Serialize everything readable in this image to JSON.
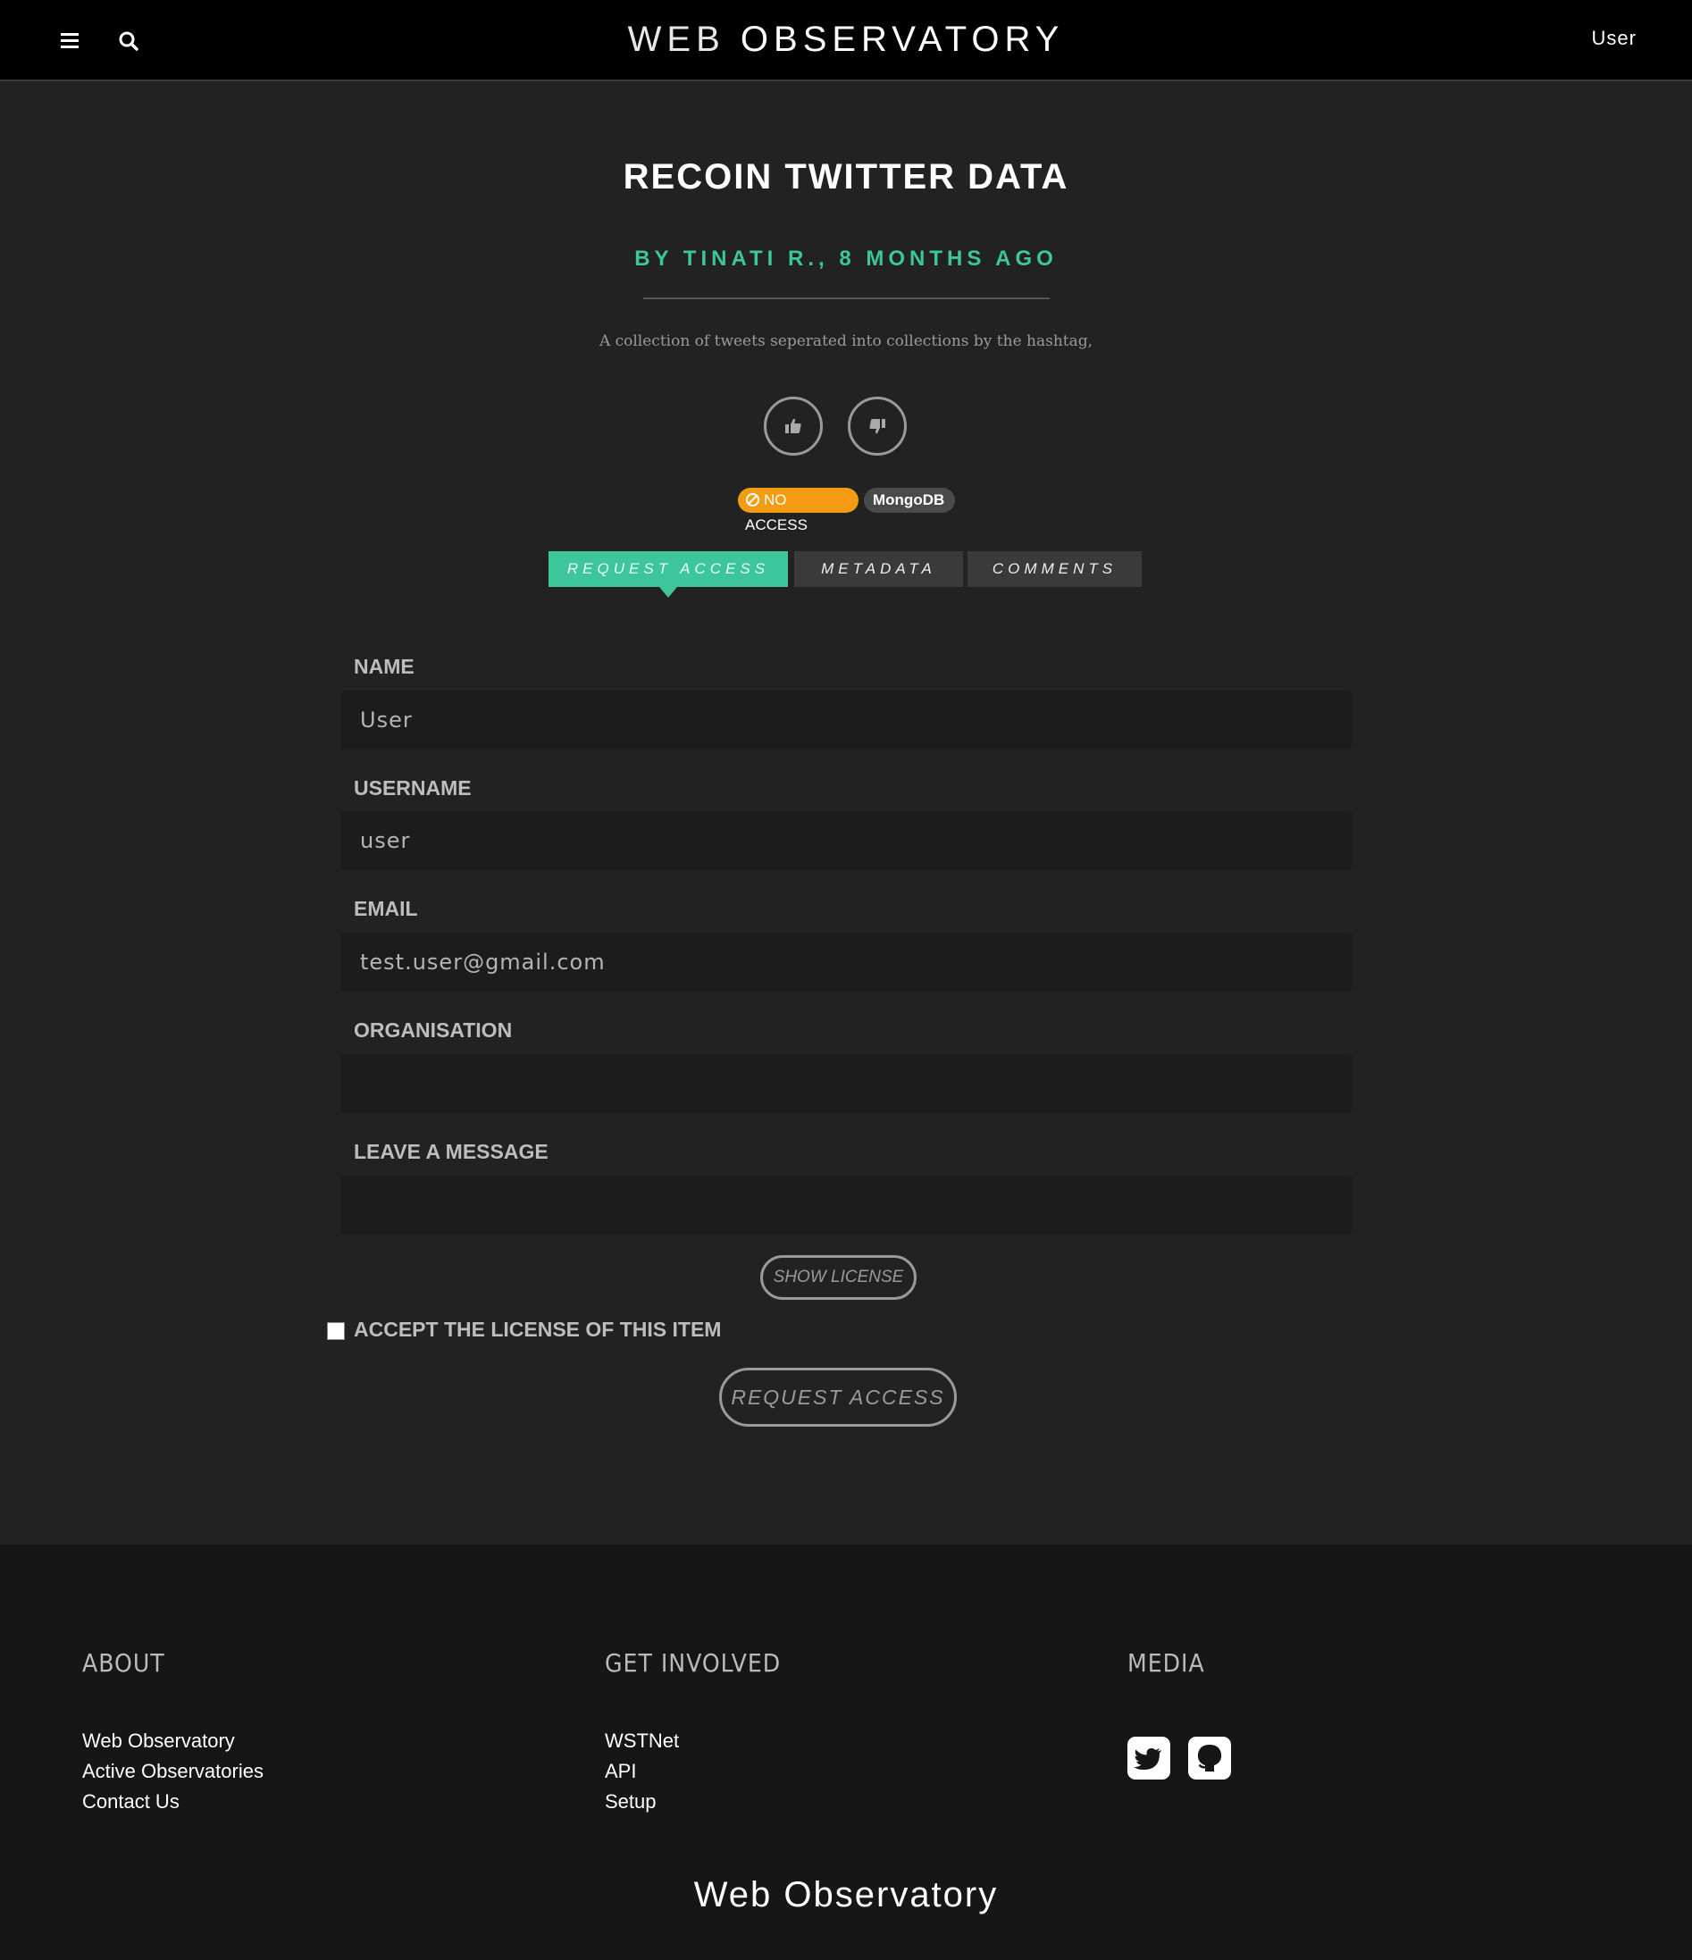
{
  "header": {
    "brand_light": "WEB ",
    "brand_bold": "OBSERVATORY",
    "user_label": "User",
    "menu_icon": "hamburger-icon",
    "search_icon": "search-icon"
  },
  "item": {
    "title": "RECOIN TWITTER DATA",
    "byline": "BY TINATI R., 8 MONTHS AGO",
    "description": "A collection of tweets seperated into collections by the hashtag,",
    "badges": {
      "access": "NO ACCESS",
      "type": "MongoDB"
    },
    "colors": {
      "accent": "#3cc69a",
      "warning": "#f39c12"
    }
  },
  "tabs": [
    {
      "label": "REQUEST ACCESS",
      "active": true
    },
    {
      "label": "METADATA",
      "active": false
    },
    {
      "label": "COMMENTS",
      "active": false
    }
  ],
  "form": {
    "name_label": "NAME",
    "name_value": "User",
    "username_label": "USERNAME",
    "username_value": "user",
    "email_label": "EMAIL",
    "email_value": "test.user@gmail.com",
    "organisation_label": "ORGANISATION",
    "organisation_value": "",
    "message_label": "LEAVE A MESSAGE",
    "message_value": "",
    "show_license": "SHOW LICENSE",
    "accept_label": "ACCEPT THE LICENSE OF THIS ITEM",
    "submit": "REQUEST ACCESS"
  },
  "footer": {
    "about_heading": "ABOUT",
    "about_links": [
      "Web Observatory",
      "Active Observatories",
      "Contact Us"
    ],
    "involved_heading": "GET INVOLVED",
    "involved_links": [
      "WSTNet",
      "API",
      "Setup"
    ],
    "media_heading": "MEDIA",
    "media_icons": [
      "twitter-icon",
      "github-icon"
    ],
    "logo": "Web Observatory"
  }
}
